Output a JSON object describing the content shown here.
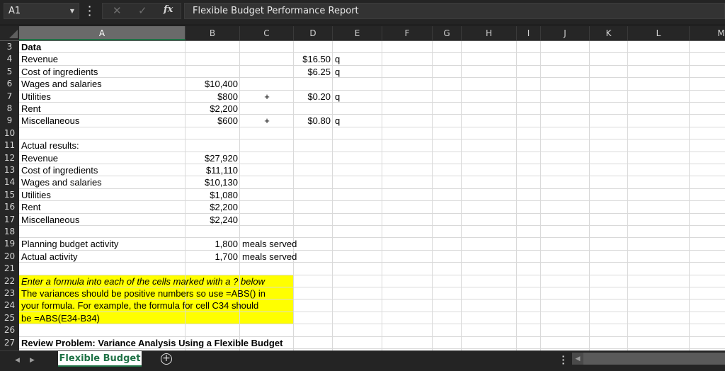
{
  "formula_bar": {
    "name_box": "A1",
    "cancel_icon": "✕",
    "enter_icon": "✓",
    "fx_label": "fx",
    "formula": "Flexible Budget Performance Report"
  },
  "columns": [
    "A",
    "B",
    "C",
    "D",
    "E",
    "F",
    "G",
    "H",
    "I",
    "J",
    "K",
    "L",
    "M"
  ],
  "selected_column": "A",
  "row_numbers": [
    "3",
    "4",
    "5",
    "6",
    "7",
    "8",
    "9",
    "10",
    "11",
    "12",
    "13",
    "14",
    "15",
    "16",
    "17",
    "18",
    "19",
    "20",
    "21",
    "22",
    "23",
    "24",
    "25",
    "26",
    "27"
  ],
  "cells": {
    "A3": "Data",
    "A4": "Revenue",
    "D4": "$16.50",
    "E4": "q",
    "A5": "Cost of ingredients",
    "D5": "$6.25",
    "E5": "q",
    "A6": "Wages and salaries",
    "B6": "$10,400",
    "A7": "Utilities",
    "B7": "$800",
    "C7": "+",
    "D7": "$0.20",
    "E7": "q",
    "A8": "Rent",
    "B8": "$2,200",
    "A9": "Miscellaneous",
    "B9": "$600",
    "C9": "+",
    "D9": "$0.80",
    "E9": "q",
    "A11": "Actual results:",
    "A12": "Revenue",
    "B12": "$27,920",
    "A13": "Cost of ingredients",
    "B13": "$11,110",
    "A14": "Wages and salaries",
    "B14": "$10,130",
    "A15": "Utilities",
    "B15": "$1,080",
    "A16": "Rent",
    "B16": "$2,200",
    "A17": "Miscellaneous",
    "B17": "$2,240",
    "A19": "Planning budget activity",
    "B19": "1,800",
    "C19": "meals served",
    "A20": "Actual activity",
    "B20": "1,700",
    "C20": "meals served",
    "A22": "Enter a formula into each of the cells marked with a ? below",
    "A23": "The variances should be positive numbers so use =ABS() in",
    "A24": "your formula. For example, the formula for cell C34 should",
    "A25": "be =ABS(E34-B34)",
    "A27": "Review Problem: Variance Analysis Using a Flexible Budget"
  },
  "highlight_color": "#ffff00",
  "accent_color": "#1e7145",
  "sheet_tabs": [
    {
      "label": "Flexible Budget",
      "active": true
    }
  ],
  "add_sheet_icon": "+"
}
